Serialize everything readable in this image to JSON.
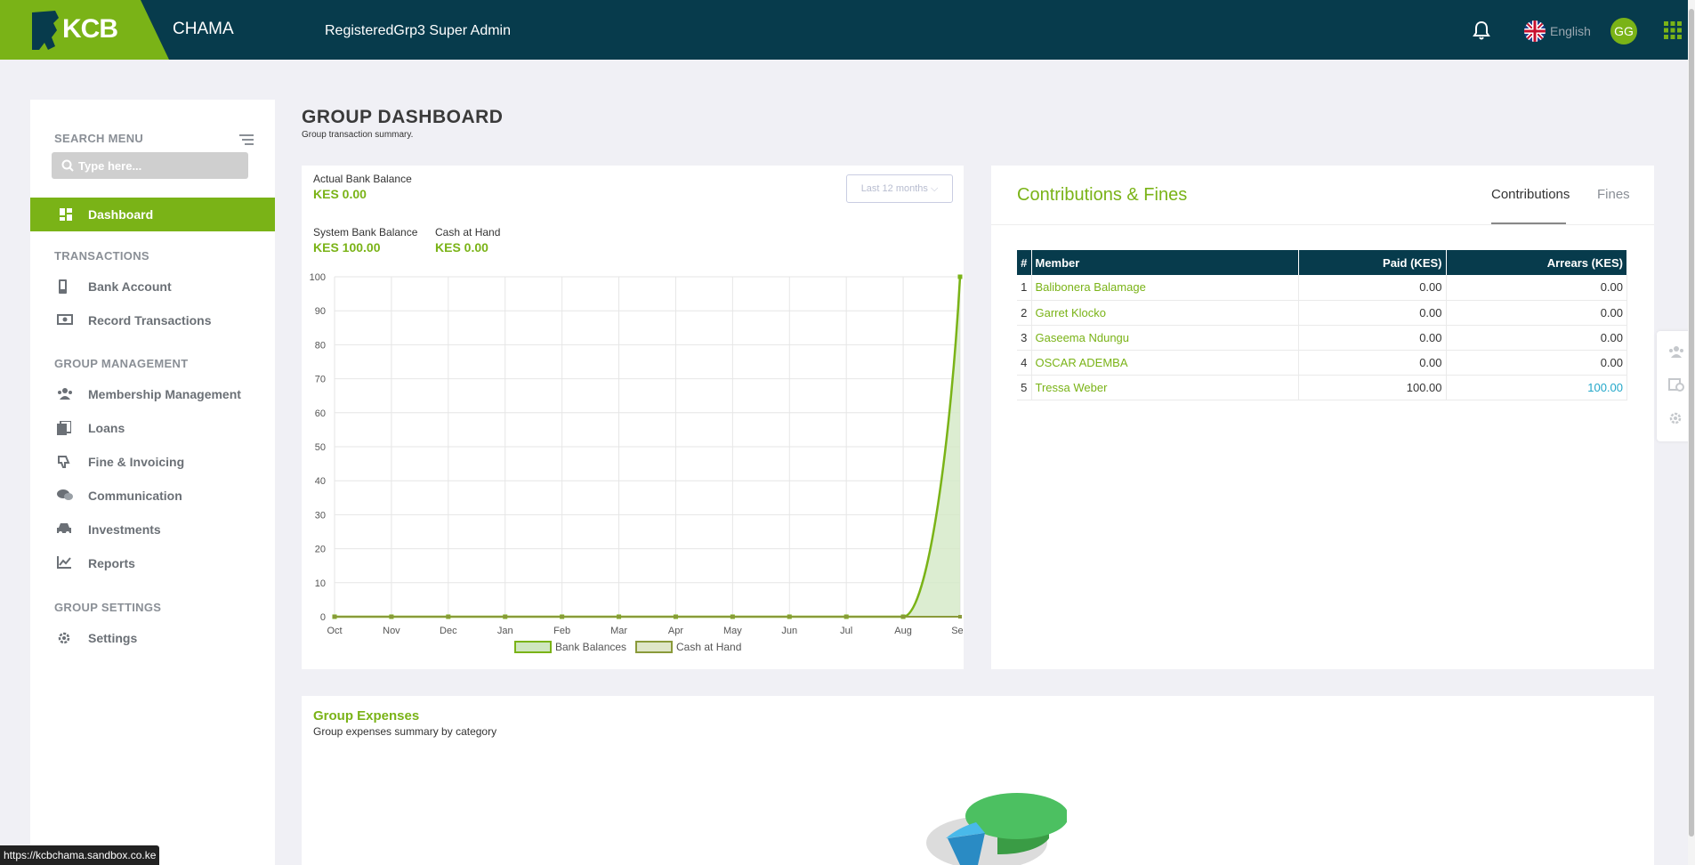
{
  "header": {
    "logo_text": "KCB",
    "app_name": "CHAMA",
    "group_name": "RegisteredGrp3 Super Admin",
    "language": "English",
    "avatar_initials": "GG"
  },
  "sidebar": {
    "search_label": "SEARCH MENU",
    "search_placeholder": "Type here...",
    "active_item": "Dashboard",
    "sections": [
      {
        "title": "TRANSACTIONS",
        "items": [
          "Bank Account",
          "Record Transactions"
        ]
      },
      {
        "title": "GROUP MANAGEMENT",
        "items": [
          "Membership Management",
          "Loans",
          "Fine & Invoicing",
          "Communication",
          "Investments",
          "Reports"
        ]
      },
      {
        "title": "GROUP SETTINGS",
        "items": [
          "Settings"
        ]
      }
    ]
  },
  "page": {
    "title": "GROUP DASHBOARD",
    "subtitle": "Group transaction summary."
  },
  "balances": {
    "actual_label": "Actual Bank Balance",
    "actual_value": "KES 0.00",
    "system_label": "System Bank Balance",
    "system_value": "KES 100.00",
    "cash_label": "Cash at Hand",
    "cash_value": "KES 0.00",
    "period": "Last 12 months"
  },
  "chart_data": {
    "type": "area",
    "categories": [
      "Oct",
      "Nov",
      "Dec",
      "Jan",
      "Feb",
      "Mar",
      "Apr",
      "May",
      "Jun",
      "Jul",
      "Aug",
      "Sep"
    ],
    "series": [
      {
        "name": "Bank Balances",
        "values": [
          0,
          0,
          0,
          0,
          0,
          0,
          0,
          0,
          0,
          0,
          0,
          100
        ]
      },
      {
        "name": "Cash at Hand",
        "values": [
          0,
          0,
          0,
          0,
          0,
          0,
          0,
          0,
          0,
          0,
          0,
          0
        ]
      }
    ],
    "ylim": [
      0,
      100
    ],
    "yticks": [
      0,
      10,
      20,
      30,
      40,
      50,
      60,
      70,
      80,
      90,
      100
    ],
    "grid": true,
    "legend": "bottom",
    "colors": {
      "line": "#7ab317",
      "fill": "#d3e8c6"
    }
  },
  "contributions": {
    "title": "Contributions & Fines",
    "tabs": [
      "Contributions",
      "Fines"
    ],
    "columns": [
      "#",
      "Member",
      "Paid (KES)",
      "Arrears (KES)"
    ],
    "rows": [
      {
        "idx": "1",
        "member": "Balibonera Balamage",
        "paid": "0.00",
        "arrears": "0.00"
      },
      {
        "idx": "2",
        "member": "Garret Klocko",
        "paid": "0.00",
        "arrears": "0.00"
      },
      {
        "idx": "3",
        "member": "Gaseema Ndungu",
        "paid": "0.00",
        "arrears": "0.00"
      },
      {
        "idx": "4",
        "member": "OSCAR ADEMBA",
        "paid": "0.00",
        "arrears": "0.00"
      },
      {
        "idx": "5",
        "member": "Tressa Weber",
        "paid": "100.00",
        "arrears": "100.00"
      }
    ]
  },
  "expenses": {
    "title": "Group Expenses",
    "subtitle": "Group expenses summary by category"
  },
  "status_url": "https://kcbchama.sandbox.co.ke",
  "colors": {
    "brand_green": "#7ab317",
    "brand_dark": "#073b4c",
    "accent_blue": "#22a7c9"
  }
}
